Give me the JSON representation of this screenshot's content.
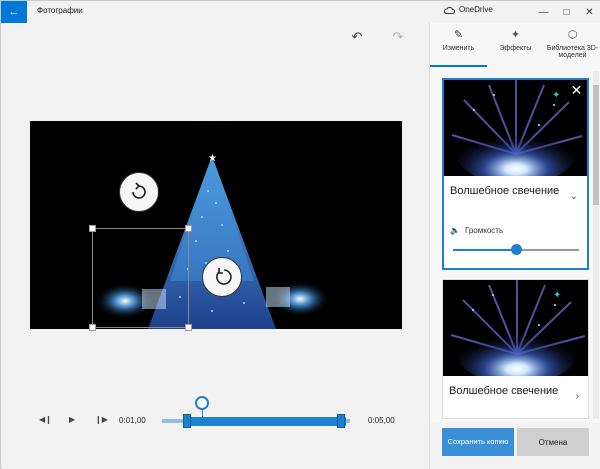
{
  "titlebar": {
    "title": "Фотографии",
    "onedrive_label": "OneDrive",
    "back_icon": "arrow-left-icon",
    "controls": [
      "minimize-icon",
      "maximize-icon",
      "close-icon"
    ]
  },
  "editor": {
    "undo_icon": "undo-icon",
    "redo_icon": "redo-icon"
  },
  "playback": {
    "start_time": "0:01,00",
    "end_time": "0:05,00",
    "buttons": [
      "skip-back-icon",
      "play-icon",
      "skip-forward-icon"
    ]
  },
  "panel": {
    "tabs": [
      {
        "label": "Изменить",
        "icon": "pencil-icon",
        "active": true
      },
      {
        "label": "Эффекты",
        "icon": "sparkle-icon",
        "active": false
      },
      {
        "label": "Библиотека 3D-моделей",
        "icon": "cube-icon",
        "active": false
      }
    ],
    "effects": [
      {
        "title": "Волшебное свечение",
        "selected": true,
        "volume_label": "Громкость",
        "volume_level": 0.5
      },
      {
        "title": "Волшебное свечение",
        "selected": false
      }
    ],
    "save_label": "Сохранить копию",
    "cancel_label": "Отмена"
  },
  "colors": {
    "accent": "#0078d7",
    "track": "#1e80cf"
  }
}
